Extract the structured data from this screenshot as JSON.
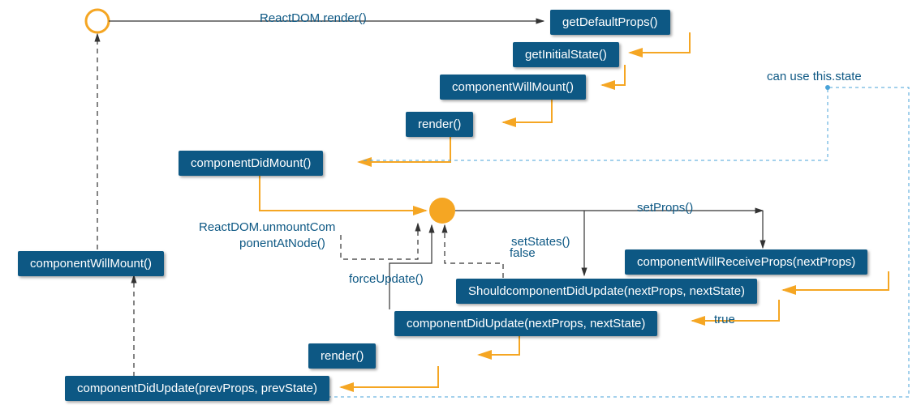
{
  "start_label": "ReactDOM.render()",
  "boxes": {
    "getDefaultProps": "getDefaultProps()",
    "getInitialState": "getInitialState()",
    "componentWillMount": "componentWillMount()",
    "render": "render()",
    "componentDidMount": "componentDidMount()",
    "leftComponentWillMount": "componentWillMount()",
    "componentWillReceiveProps": "componentWillReceiveProps(nextProps)",
    "shouldComponentDidUpdate": "ShouldcomponentDidUpdate(nextProps, nextState)",
    "componentDidUpdateMid": "componentDidUpdate(nextProps, nextState)",
    "render2": "render()",
    "componentDidUpdateBottom": "componentDidUpdate(prevProps, prevState)"
  },
  "labels": {
    "canUseThisState": "can use this.state",
    "setProps": "setProps()",
    "setStates": "setStates()",
    "unmountLine1": "ReactDOM.unmountCom",
    "unmountLine2": "ponentAtNode()",
    "forceUpdate": "forceUpdate()",
    "false": "false",
    "true": "true"
  },
  "colors": {
    "node_fill": "#0d5884",
    "accent": "#f5a623",
    "dashed_blue": "#4aa3d8"
  }
}
